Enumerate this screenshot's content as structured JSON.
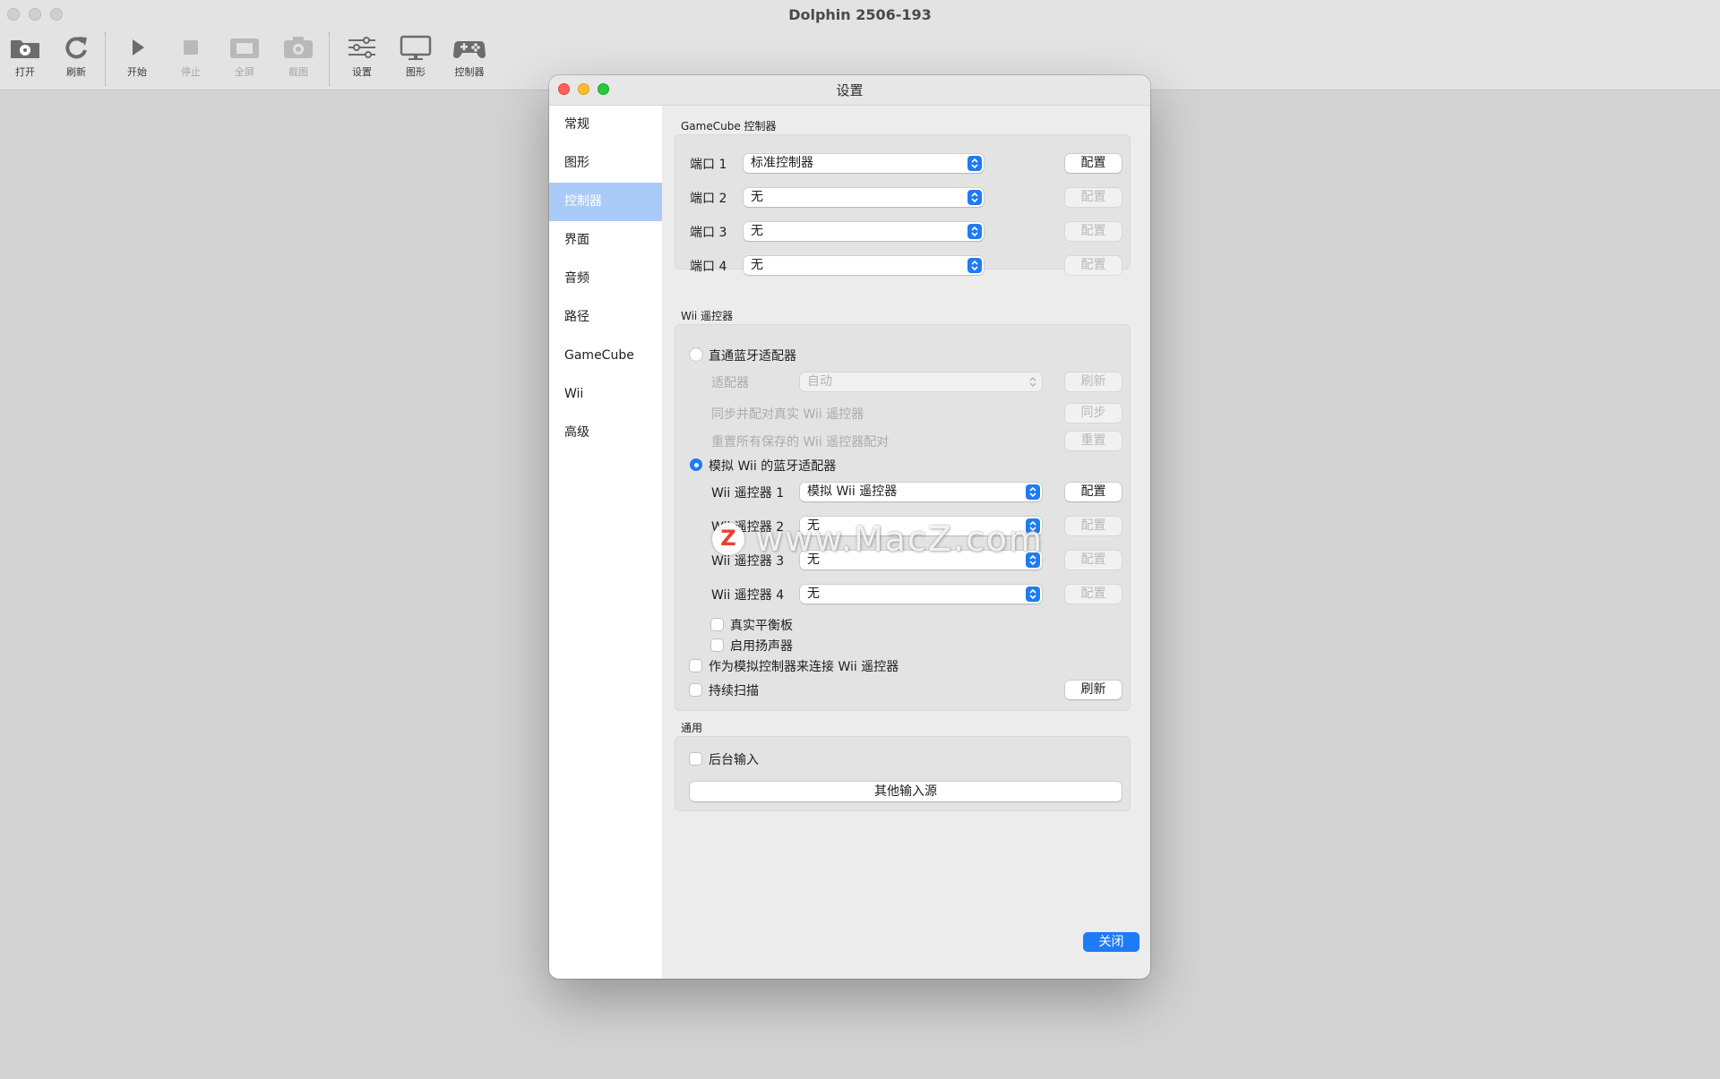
{
  "app": {
    "title": "Dolphin 2506-193"
  },
  "toolbar": {
    "open": "打开",
    "refresh": "刷新",
    "play": "开始",
    "stop": "停止",
    "fullscreen": "全屏",
    "screenshot": "截图",
    "config": "设置",
    "graphics": "图形",
    "controllers": "控制器"
  },
  "dialog": {
    "title": "设置",
    "sidebar": [
      {
        "label": "常规"
      },
      {
        "label": "图形"
      },
      {
        "label": "控制器",
        "active": true
      },
      {
        "label": "界面"
      },
      {
        "label": "音频"
      },
      {
        "label": "路径"
      },
      {
        "label": "GameCube"
      },
      {
        "label": "Wii"
      },
      {
        "label": "高级"
      }
    ],
    "gamecube": {
      "title": "GameCube 控制器",
      "ports": [
        {
          "label": "端口 1",
          "value": "标准控制器",
          "button": "配置",
          "button_enabled": true
        },
        {
          "label": "端口 2",
          "value": "无",
          "button": "配置",
          "button_enabled": false
        },
        {
          "label": "端口 3",
          "value": "无",
          "button": "配置",
          "button_enabled": false
        },
        {
          "label": "端口 4",
          "value": "无",
          "button": "配置",
          "button_enabled": false
        }
      ]
    },
    "wii": {
      "title": "Wii 遥控器",
      "passthrough_label": "直通蓝牙适配器",
      "passthrough_selected": false,
      "adapter_label": "适配器",
      "adapter_value": "自动",
      "adapter_refresh": "刷新",
      "sync_label": "同步并配对真实 Wii 遥控器",
      "sync_button": "同步",
      "reset_label": "重置所有保存的 Wii 遥控器配对",
      "reset_button": "重置",
      "emulated_label": "模拟 Wii 的蓝牙适配器",
      "emulated_selected": true,
      "remotes": [
        {
          "label": "Wii 遥控器 1",
          "value": "模拟 Wii 遥控器",
          "button": "配置",
          "button_enabled": true
        },
        {
          "label": "Wii 遥控器 2",
          "value": "无",
          "button": "配置",
          "button_enabled": false
        },
        {
          "label": "Wii 遥控器 3",
          "value": "无",
          "button": "配置",
          "button_enabled": false
        },
        {
          "label": "Wii 遥控器 4",
          "value": "无",
          "button": "配置",
          "button_enabled": false
        }
      ],
      "balance_board": "真实平衡板",
      "speaker": "启用扬声器",
      "connect_as_emulated": "作为模拟控制器来连接 Wii 遥控器",
      "continuous_scan": "持续扫描",
      "refresh_button": "刷新"
    },
    "general": {
      "title": "通用",
      "background_input": "后台输入",
      "alternate_input_sources": "其他输入源"
    },
    "close_button": "关闭"
  },
  "watermark": {
    "text": "www.MacZ.com",
    "logo": "Z"
  },
  "colors": {
    "accent": "#1f7bf5",
    "sidebar_selected": "#aacbf7"
  }
}
